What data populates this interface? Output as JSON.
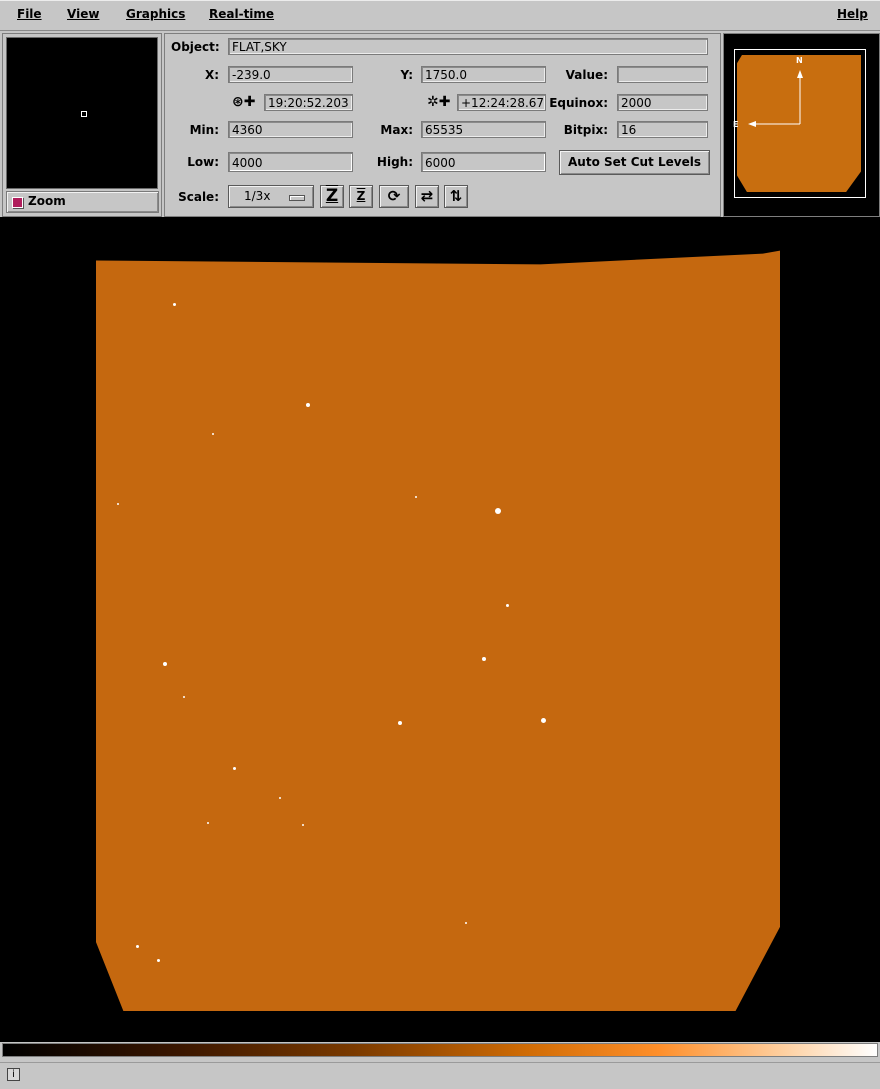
{
  "menubar": {
    "file": "File",
    "view": "View",
    "graphics": "Graphics",
    "realtime": "Real-time",
    "help": "Help"
  },
  "zoom": {
    "label": "Zoom",
    "checked": true
  },
  "info": {
    "object_label": "Object:",
    "object_value": "FLAT,SKY",
    "x_label": "X:",
    "x_value": "-239.0",
    "y_label": "Y:",
    "y_value": "1750.0",
    "value_label": "Value:",
    "value_value": "",
    "ra_value": "19:20:52.203",
    "dec_value": "+12:24:28.67",
    "equinox_label": "Equinox:",
    "equinox_value": "2000",
    "min_label": "Min:",
    "min_value": "4360",
    "max_label": "Max:",
    "max_value": "65535",
    "bitpix_label": "Bitpix:",
    "bitpix_value": "16",
    "low_label": "Low:",
    "low_value": "4000",
    "high_label": "High:",
    "high_value": "6000",
    "auto_cut_button": "Auto Set Cut Levels",
    "scale_label": "Scale:",
    "scale_value": "1/3x"
  },
  "panner": {
    "north_label": "N",
    "east_label": "E"
  },
  "colors": {
    "image_orange": "#c5680f",
    "panel_gray": "#c6c6c6",
    "check_magenta": "#b01e5c"
  },
  "icons": {
    "ra": "ra-icon",
    "dec": "dec-icon",
    "zoom_in": "zoom-in-icon",
    "zoom_out": "zoom-out-icon",
    "rotate": "rotate-icon",
    "flip_x": "flip-horizontal-icon",
    "flip_y": "flip-vertical-icon",
    "info": "info-icon"
  }
}
